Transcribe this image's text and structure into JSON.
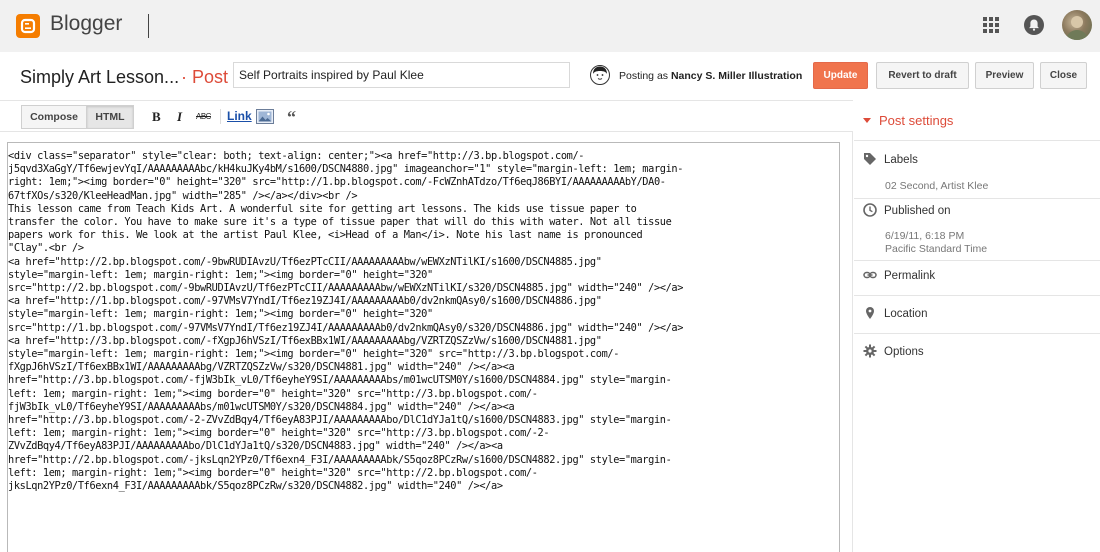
{
  "app": {
    "name": "Blogger",
    "brand_color": "#f57d00"
  },
  "header": {
    "blog_title": "Simply Art Lesson...",
    "crumb_separator": "·",
    "crumb": "Post",
    "post_title_value": "Self Portraits inspired by Paul Klee",
    "posting_as_prefix": "Posting as",
    "posting_as_name": "Nancy S. Miller Illustration"
  },
  "actions": {
    "update": "Update",
    "revert": "Revert to draft",
    "preview": "Preview",
    "close": "Close",
    "accent_color": "#f0744d"
  },
  "toolbar": {
    "compose": "Compose",
    "html": "HTML",
    "bold": "B",
    "italic": "I",
    "strike": "ABC",
    "link": "Link",
    "quote": "“"
  },
  "editor": {
    "lines": [
      "<div class=\"separator\" style=\"clear: both; text-align: center;\"><a href=\"http://3.bp.blogspot.com/-",
      "j5qvd3XaGgY/Tf6ewjevYqI/AAAAAAAAAbc/kH4kuJKy4bM/s1600/DSCN4880.jpg\" imageanchor=\"1\" style=\"margin-left: 1em; margin-",
      "right: 1em;\"><img border=\"0\" height=\"320\" src=\"http://1.bp.blogspot.com/-FcWZnhATdzo/Tf6eqJ86BYI/AAAAAAAAAbY/DA0-",
      "67tfXOs/s320/KleeHeadMan.jpg\" width=\"285\" /></a></div><br />",
      "This lesson came from Teach Kids Art. A wonderful site for getting art lessons. The kids use tissue paper to",
      "transfer the color. You have to make sure it's a type of tissue paper that will do this with water. Not all tissue",
      "papers work for this. We look at the artist Paul Klee, <i>Head of a Man</i>. Note his last name is pronounced",
      "\"Clay\".<br />",
      "<a href=\"http://2.bp.blogspot.com/-9bwRUDIAvzU/Tf6ezPTcCII/AAAAAAAAAbw/wEWXzNTilKI/s1600/DSCN4885.jpg\"",
      "style=\"margin-left: 1em; margin-right: 1em;\"><img border=\"0\" height=\"320\"",
      "src=\"http://2.bp.blogspot.com/-9bwRUDIAvzU/Tf6ezPTcCII/AAAAAAAAAbw/wEWXzNTilKI/s320/DSCN4885.jpg\" width=\"240\" /></a>",
      "<a href=\"http://1.bp.blogspot.com/-97VMsV7YndI/Tf6ez19ZJ4I/AAAAAAAAAb0/dv2nkmQAsy0/s1600/DSCN4886.jpg\"",
      "style=\"margin-left: 1em; margin-right: 1em;\"><img border=\"0\" height=\"320\"",
      "src=\"http://1.bp.blogspot.com/-97VMsV7YndI/Tf6ez19ZJ4I/AAAAAAAAAb0/dv2nkmQAsy0/s320/DSCN4886.jpg\" width=\"240\" /></a>",
      "<a href=\"http://3.bp.blogspot.com/-fXgpJ6hVSzI/Tf6exBBx1WI/AAAAAAAAAbg/VZRTZQSZzVw/s1600/DSCN4881.jpg\"",
      "style=\"margin-left: 1em; margin-right: 1em;\"><img border=\"0\" height=\"320\" src=\"http://3.bp.blogspot.com/-",
      "fXgpJ6hVSzI/Tf6exBBx1WI/AAAAAAAAAbg/VZRTZQSZzVw/s320/DSCN4881.jpg\" width=\"240\" /></a><a",
      "href=\"http://3.bp.blogspot.com/-fjW3bIk_vL0/Tf6eyheY9SI/AAAAAAAAAbs/m01wcUTSM0Y/s1600/DSCN4884.jpg\" style=\"margin-",
      "left: 1em; margin-right: 1em;\"><img border=\"0\" height=\"320\" src=\"http://3.bp.blogspot.com/-",
      "fjW3bIk_vL0/Tf6eyheY9SI/AAAAAAAAAbs/m01wcUTSM0Y/s320/DSCN4884.jpg\" width=\"240\" /></a><a",
      "href=\"http://3.bp.blogspot.com/-2-ZVvZdBqy4/Tf6eyA83PJI/AAAAAAAAAbo/DlC1dYJa1tQ/s1600/DSCN4883.jpg\" style=\"margin-",
      "left: 1em; margin-right: 1em;\"><img border=\"0\" height=\"320\" src=\"http://3.bp.blogspot.com/-2-",
      "ZVvZdBqy4/Tf6eyA83PJI/AAAAAAAAAbo/DlC1dYJa1tQ/s320/DSCN4883.jpg\" width=\"240\" /></a><a",
      "href=\"http://2.bp.blogspot.com/-jksLqn2YPz0/Tf6exn4_F3I/AAAAAAAAAbk/S5qoz8PCzRw/s1600/DSCN4882.jpg\" style=\"margin-",
      "left: 1em; margin-right: 1em;\"><img border=\"0\" height=\"320\" src=\"http://2.bp.blogspot.com/-",
      "jksLqn2YPz0/Tf6exn4_F3I/AAAAAAAAAbk/S5qoz8PCzRw/s320/DSCN4882.jpg\" width=\"240\" /></a>"
    ]
  },
  "post_settings": {
    "heading": "Post settings",
    "heading_color": "#dd4b39",
    "labels": {
      "title": "Labels",
      "value": "02 Second, Artist Klee",
      "icon": "label-icon"
    },
    "published": {
      "title": "Published on",
      "date": "6/19/11, 6:18 PM",
      "timezone": "Pacific Standard Time",
      "icon": "clock-icon"
    },
    "permalink": {
      "title": "Permalink",
      "icon": "link-icon"
    },
    "location": {
      "title": "Location",
      "icon": "location-pin-icon"
    },
    "options": {
      "title": "Options",
      "icon": "gear-icon"
    }
  },
  "icons": {
    "apps": "apps-grid-icon",
    "notifications": "notification-bell-icon",
    "account": "account-avatar"
  }
}
